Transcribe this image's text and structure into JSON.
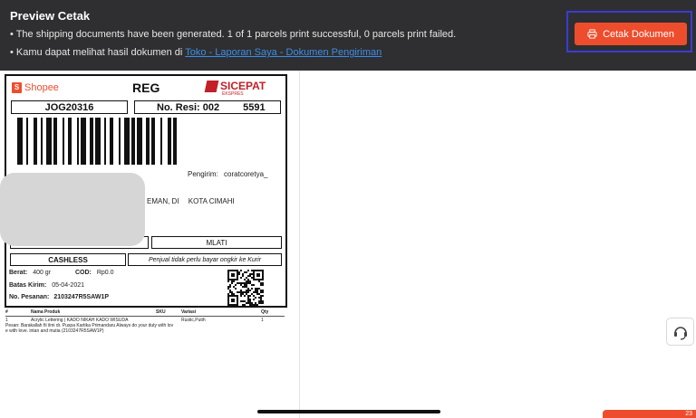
{
  "banner": {
    "title": "Preview Cetak",
    "line1": "• The shipping documents have been generated. 1 of 1 parcels print successful, 0 parcels print failed.",
    "line2_prefix": "• Kamu dapat melihat hasil dokumen di ",
    "line2_link": "Toko - Laporan Saya - Dokumen Pengiriman",
    "print_button": "Cetak Dokumen"
  },
  "label": {
    "brand": "Shopee",
    "service": "REG",
    "courier": "SICEPAT",
    "courier_sub": "EKSPRES",
    "order_code": "JOG20316",
    "resi_label": "No. Resi: 002",
    "resi_tail": "5591",
    "sender_label": "Pengirim:",
    "sender_name": "coratcoretya_",
    "origin_fragment": "EMAN, DI",
    "destination_city": "KOTA CIMAHI",
    "district": "MLATI",
    "payment": "CASHLESS",
    "payment_note": "Penjual tidak perlu bayar ongkir ke Kurir",
    "weight_label": "Berat:",
    "weight": "400 gr",
    "cod_label": "COD:",
    "cod": "Rp0.0",
    "deadline_label": "Batas Kirim:",
    "deadline": "05-04-2021",
    "order_no_label": "No. Pesanan:",
    "order_no": "2103247R5SAW1P",
    "items_header": [
      "#",
      "Nama Produk",
      "SKU",
      "Variasi",
      "Qty"
    ],
    "items": [
      [
        "1",
        "Acrylic Lettering | KADO NIKAH KADO WISUDA",
        "",
        "Rustic,Putih",
        "1"
      ]
    ],
    "note_line1": "Pesan: Barakallah fii ilmi dr. Puspa Kartika Primandaru Always do your duty with lov",
    "note_line2": "e with love. intan and mutia (2103247R5SAW1P)"
  },
  "badge_count": "23"
}
